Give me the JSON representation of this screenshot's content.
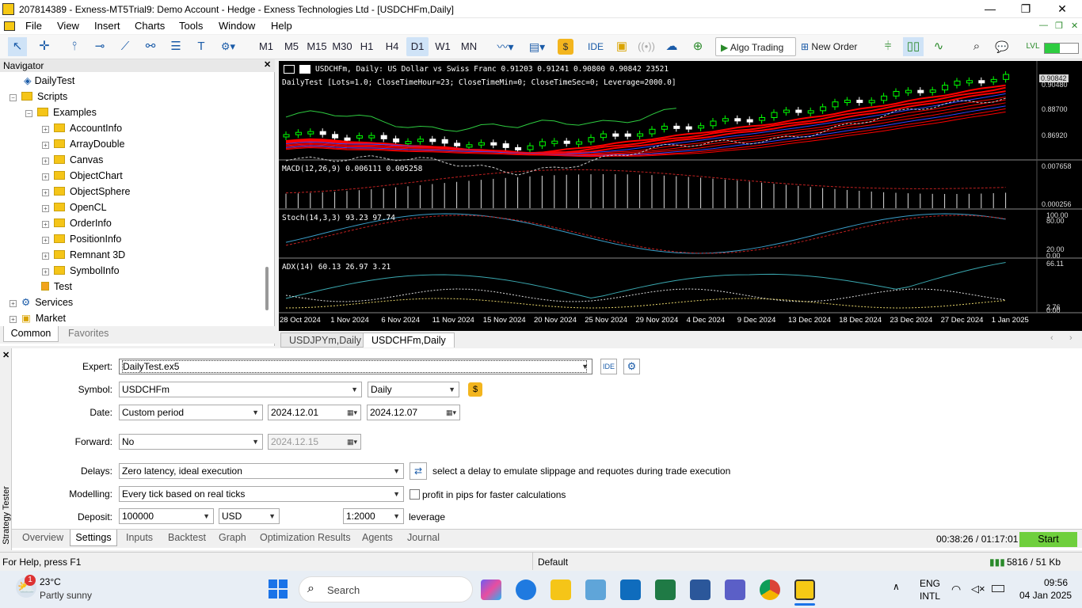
{
  "window": {
    "title": "207814389 - Exness-MT5Trial9: Demo Account - Hedge - Exness Technologies Ltd - [USDCHFm,Daily]"
  },
  "menu": [
    "File",
    "View",
    "Insert",
    "Charts",
    "Tools",
    "Window",
    "Help"
  ],
  "toolbar": {
    "timeframes": [
      "M1",
      "M5",
      "M15",
      "M30",
      "H1",
      "H4",
      "D1",
      "W1",
      "MN"
    ],
    "selected_timeframe": "D1",
    "ide_label": "IDE",
    "algo_trading_label": "Algo Trading",
    "new_order_label": "New Order",
    "notification_count": "1"
  },
  "navigator": {
    "title": "Navigator",
    "items": [
      {
        "label": "DailyTest",
        "kind": "expert",
        "indent": 2
      },
      {
        "label": "Scripts",
        "kind": "folder",
        "indent": 1,
        "expander": "-"
      },
      {
        "label": "Examples",
        "kind": "folder",
        "indent": 2,
        "expander": "-"
      },
      {
        "label": "AccountInfo",
        "kind": "folder",
        "indent": 3,
        "expander": "+"
      },
      {
        "label": "ArrayDouble",
        "kind": "folder",
        "indent": 3,
        "expander": "+"
      },
      {
        "label": "Canvas",
        "kind": "folder",
        "indent": 3,
        "expander": "+"
      },
      {
        "label": "ObjectChart",
        "kind": "folder",
        "indent": 3,
        "expander": "+"
      },
      {
        "label": "ObjectSphere",
        "kind": "folder",
        "indent": 3,
        "expander": "+"
      },
      {
        "label": "OpenCL",
        "kind": "folder",
        "indent": 3,
        "expander": "+"
      },
      {
        "label": "OrderInfo",
        "kind": "folder",
        "indent": 3,
        "expander": "+"
      },
      {
        "label": "PositionInfo",
        "kind": "folder",
        "indent": 3,
        "expander": "+"
      },
      {
        "label": "Remnant 3D",
        "kind": "folder",
        "indent": 3,
        "expander": "+"
      },
      {
        "label": "SymbolInfo",
        "kind": "folder",
        "indent": 3,
        "expander": "+"
      },
      {
        "label": "Test",
        "kind": "script",
        "indent": 2
      },
      {
        "label": "Services",
        "kind": "services",
        "indent": 1,
        "expander": "+"
      },
      {
        "label": "Market",
        "kind": "market",
        "indent": 1,
        "expander": "+"
      }
    ],
    "tabs": [
      "Common",
      "Favorites"
    ]
  },
  "chart": {
    "header": "USDCHFm, Daily:  US Dollar vs Swiss Franc  0.91203 0.91241 0.90800 0.90842  23521",
    "ea_info": "DailyTest [Lots=1.0; CloseTimeHour=23; CloseTimeMin=0; CloseTimeSec=0; Leverage=2000.0]",
    "price_labels": [
      "0.90842",
      "0.90480",
      "0.88700",
      "0.86920"
    ],
    "macd_label": "MACD(12,26,9) 0.006111 0.005258",
    "macd_scale": [
      "0.007658",
      "0.000256"
    ],
    "stoch_label": "Stoch(14,3,3) 93.23 97.74",
    "stoch_scale": [
      "100.00",
      "80.00",
      "20.00",
      "0.00"
    ],
    "adx_label": "ADX(14) 60.13 26.97 3.21",
    "adx_scale": [
      "66.11",
      "2.76",
      "0.00"
    ],
    "dates": [
      "28 Oct 2024",
      "1 Nov 2024",
      "6 Nov 2024",
      "11 Nov 2024",
      "15 Nov 2024",
      "20 Nov 2024",
      "25 Nov 2024",
      "29 Nov 2024",
      "4 Dec 2024",
      "9 Dec 2024",
      "13 Dec 2024",
      "18 Dec 2024",
      "23 Dec 2024",
      "27 Dec 2024",
      "1 Jan 2025"
    ],
    "tabs": [
      "USDJPYm,Daily",
      "USDCHFm,Daily"
    ]
  },
  "tester": {
    "side_label": "Strategy Tester",
    "expert_label": "Expert:",
    "expert_value": "DailyTest.ex5",
    "ide_label": "IDE",
    "symbol_label": "Symbol:",
    "symbol_value": "USDCHFm",
    "period_value": "Daily",
    "date_label": "Date:",
    "date_mode": "Custom period",
    "date_from": "2024.12.01",
    "date_to": "2024.12.07",
    "forward_label": "Forward:",
    "forward_value": "No",
    "forward_date": "2024.12.15",
    "delays_label": "Delays:",
    "delays_value": "Zero latency, ideal execution",
    "delays_hint": "select a delay to emulate slippage and requotes during trade execution",
    "modelling_label": "Modelling:",
    "modelling_value": "Every tick based on real ticks",
    "pips_label": "profit in pips for faster calculations",
    "deposit_label": "Deposit:",
    "deposit_value": "100000",
    "currency_value": "USD",
    "leverage_value": "1:2000",
    "leverage_label": "leverage",
    "tabs": [
      "Overview",
      "Settings",
      "Inputs",
      "Backtest",
      "Graph",
      "Optimization Results",
      "Agents",
      "Journal"
    ],
    "active_tab": "Settings",
    "timer": "00:38:26 / 01:17:01",
    "start_label": "Start"
  },
  "status": {
    "help": "For Help, press F1",
    "profile": "Default",
    "traffic": "5816 / 51 Kb"
  },
  "taskbar": {
    "weather_temp": "23°C",
    "weather_desc": "Partly sunny",
    "weather_badge": "1",
    "search_label": "Search",
    "lang1": "ENG",
    "lang2": "INTL",
    "time": "09:56",
    "date": "04 Jan 2025"
  },
  "colors": {
    "bull_candle": "#00ff00",
    "bear_candle": "#ffffff",
    "ma_lines": "#ff0000",
    "start_button": "#6fcf3d"
  }
}
